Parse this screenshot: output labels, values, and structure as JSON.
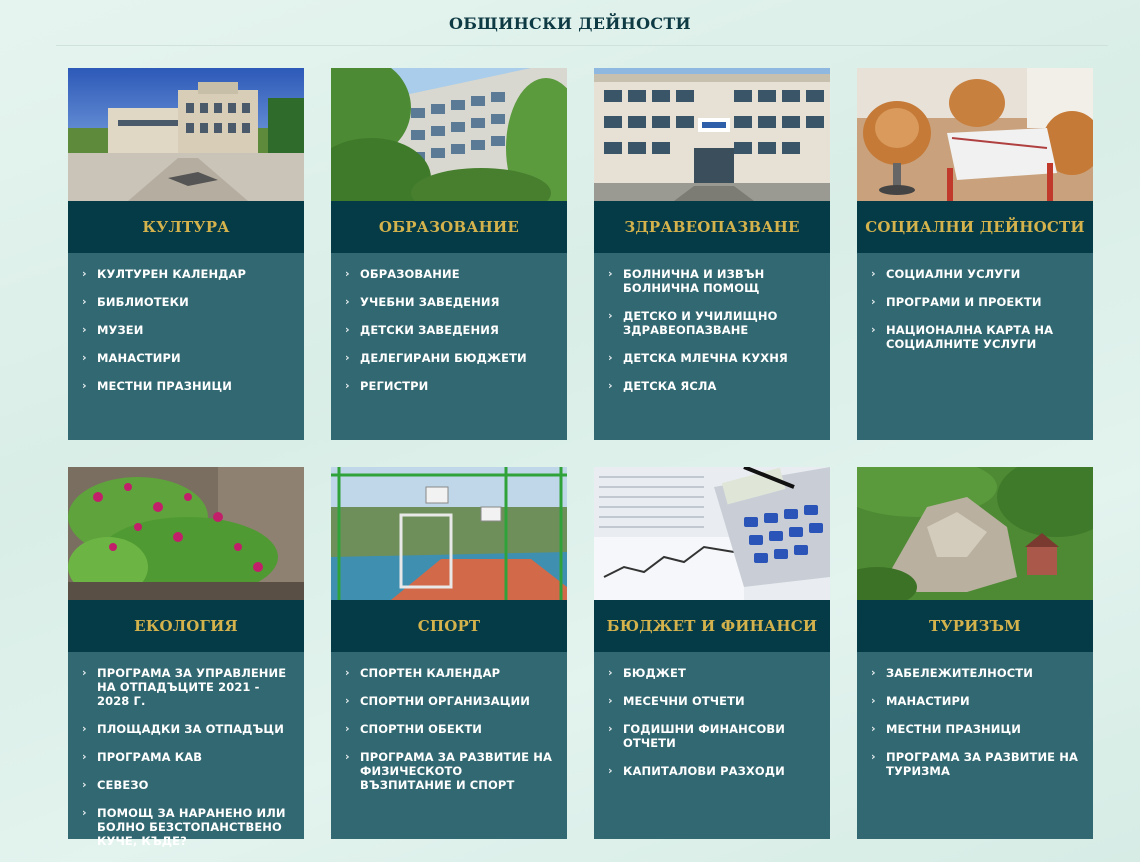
{
  "section": {
    "title": "ОБЩИНСКИ ДЕЙНОСТИ"
  },
  "cards": [
    {
      "title": "КУЛТУРА",
      "image": "culture-building-photo",
      "links": [
        "КУЛТУРЕН КАЛЕНДАР",
        "БИБЛИОТЕКИ",
        "МУЗЕИ",
        "МАНАСТИРИ",
        "МЕСТНИ ПРАЗНИЦИ"
      ]
    },
    {
      "title": "ОБРАЗОВАНИЕ",
      "image": "school-building-photo",
      "links": [
        "ОБРАЗОВАНИЕ",
        "УЧЕБНИ ЗАВЕДЕНИЯ",
        "ДЕТСКИ ЗАВЕДЕНИЯ",
        "ДЕЛЕГИРАНИ БЮДЖЕТИ",
        "РЕГИСТРИ"
      ]
    },
    {
      "title": "ЗДРАВЕОПАЗВАНЕ",
      "image": "hospital-building-photo",
      "links": [
        "БОЛНИЧНА И ИЗВЪН БОЛНИЧНА ПОМОЩ",
        "ДЕТСКО И УЧИЛИЩНО ЗДРАВЕОПАЗВАНЕ",
        "ДЕТСКА МЛЕЧНА КУХНЯ",
        "ДЕТСКА ЯСЛА"
      ]
    },
    {
      "title": "СОЦИАЛНИ ДЕЙНОСТИ",
      "image": "social-room-photo",
      "links": [
        "СОЦИАЛНИ УСЛУГИ",
        "ПРОГРАМИ И ПРОЕКТИ",
        "НАЦИОНАЛНА КАРТА НА СОЦИАЛНИТЕ УСЛУГИ"
      ]
    },
    {
      "title": "ЕКОЛОГИЯ",
      "image": "flowers-plant-photo",
      "links": [
        "ПРОГРАМА ЗА УПРАВЛЕНИЕ НА ОТПАДЪЦИТЕ 2021 - 2028 Г.",
        "ПЛОЩАДКИ ЗА ОТПАДЪЦИ",
        "ПРОГРАМА КАВ",
        "СЕВЕЗО",
        "ПОМОЩ ЗА НАРАНЕНО ИЛИ БОЛНО БЕЗСТОПАНСТВЕНО КУЧЕ, КЪДЕ?"
      ]
    },
    {
      "title": "СПОРТ",
      "image": "sports-court-photo",
      "links": [
        "СПОРТЕН КАЛЕНДАР",
        "СПОРТНИ ОРГАНИЗАЦИИ",
        "СПОРТНИ ОБЕКТИ",
        "ПРОГРАМА ЗА РАЗВИТИЕ НА ФИЗИЧЕСКОТО ВЪЗПИТАНИЕ И СПОРТ"
      ]
    },
    {
      "title": "БЮДЖЕТ И ФИНАНСИ",
      "image": "finance-calculator-photo",
      "links": [
        "БЮДЖЕТ",
        "МЕСЕЧНИ ОТЧЕТИ",
        "ГОДИШНИ ФИНАНСОВИ ОТЧЕТИ",
        "КАПИТАЛОВИ РАЗХОДИ"
      ]
    },
    {
      "title": "ТУРИЗЪМ",
      "image": "fortress-landscape-photo",
      "links": [
        "ЗАБЕЛЕЖИТЕЛНОСТИ",
        "МАНАСТИРИ",
        "МЕСТНИ ПРАЗНИЦИ",
        "ПРОГРАМА ЗА РАЗВИТИЕ НА ТУРИЗМА"
      ]
    }
  ]
}
